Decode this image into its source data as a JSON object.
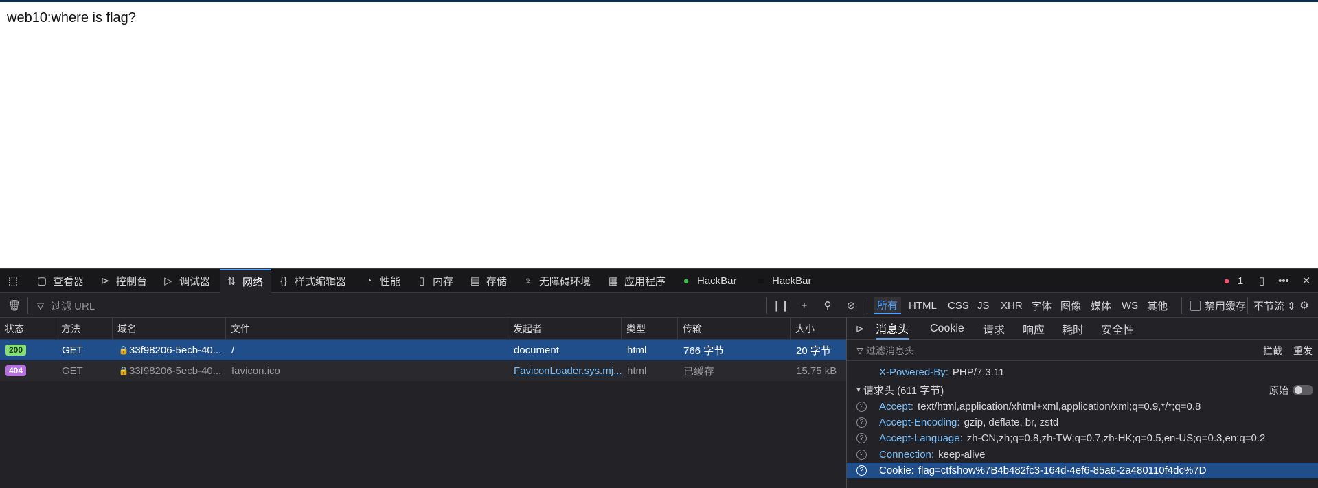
{
  "page": {
    "text": "web10:where is flag?"
  },
  "devtools": {
    "tabs": [
      {
        "icon": "pick-element-icon",
        "label": ""
      },
      {
        "icon": "inspector-icon",
        "label": "查看器"
      },
      {
        "icon": "console-icon",
        "label": "控制台"
      },
      {
        "icon": "debugger-icon",
        "label": "调试器"
      },
      {
        "icon": "network-icon",
        "label": "网络"
      },
      {
        "icon": "style-editor-icon",
        "label": "样式编辑器"
      },
      {
        "icon": "performance-icon",
        "label": "性能"
      },
      {
        "icon": "memory-icon",
        "label": "内存"
      },
      {
        "icon": "storage-icon",
        "label": "存储"
      },
      {
        "icon": "accessibility-icon",
        "label": "无障碍环境"
      },
      {
        "icon": "application-icon",
        "label": "应用程序"
      },
      {
        "icon": "hackbar-green-icon",
        "label": "HackBar"
      },
      {
        "icon": "hackbar-dark-icon",
        "label": "HackBar"
      }
    ],
    "error_count": "1",
    "toolbar": {
      "filter_placeholder": "过滤 URL",
      "type_filters": [
        "所有",
        "HTML",
        "CSS",
        "JS",
        "XHR",
        "字体",
        "图像",
        "媒体",
        "WS",
        "其他"
      ],
      "disable_cache": "禁用缓存",
      "throttle": "不节流 ⇕"
    },
    "columns": [
      "状态",
      "方法",
      "域名",
      "文件",
      "发起者",
      "类型",
      "传输",
      "大小"
    ],
    "requests": [
      {
        "status": "200",
        "method": "GET",
        "domain": "33f98206-5ecb-40...",
        "file": "/",
        "initiator": "document",
        "type": "html",
        "transfer": "766 字节",
        "size": "20 字节"
      },
      {
        "status": "404",
        "method": "GET",
        "domain": "33f98206-5ecb-40...",
        "file": "favicon.ico",
        "initiator": "FaviconLoader.sys.mj...",
        "type": "html",
        "transfer": "已缓存",
        "size": "15.75 kB"
      }
    ],
    "panel": {
      "tabs": [
        "消息头",
        "Cookie",
        "请求",
        "响应",
        "耗时",
        "安全性"
      ],
      "filter_placeholder": "过滤消息头",
      "block": "拦截",
      "resend": "重发",
      "powered_by": {
        "name": "X-Powered-By:",
        "value": "PHP/7.3.11"
      },
      "request_headers_title": "请求头 (611 字节)",
      "raw": "原始",
      "headers": [
        {
          "name": "Accept:",
          "value": "text/html,application/xhtml+xml,application/xml;q=0.9,*/*;q=0.8"
        },
        {
          "name": "Accept-Encoding:",
          "value": "gzip, deflate, br, zstd"
        },
        {
          "name": "Accept-Language:",
          "value": "zh-CN,zh;q=0.8,zh-TW;q=0.7,zh-HK;q=0.5,en-US;q=0.3,en;q=0.2"
        },
        {
          "name": "Connection:",
          "value": "keep-alive"
        },
        {
          "name": "Cookie:",
          "value": "flag=ctfshow%7B4b482fc3-164d-4ef6-85a6-2a480110f4dc%7D"
        }
      ]
    }
  }
}
